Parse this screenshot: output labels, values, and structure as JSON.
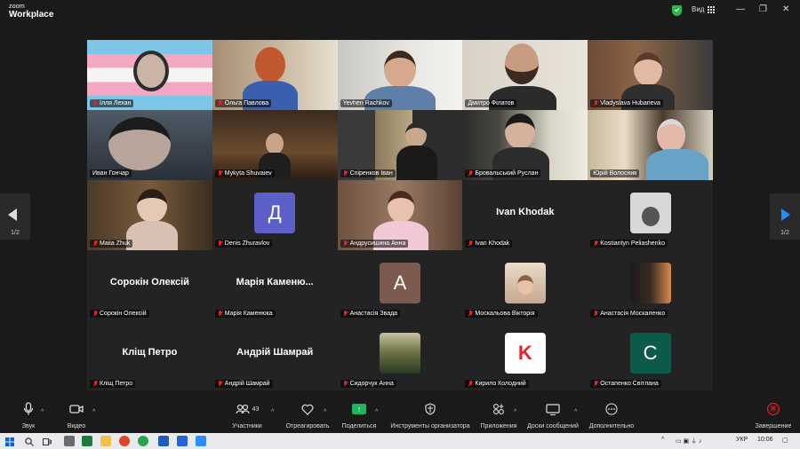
{
  "app": {
    "logo_top": "zoom",
    "logo_bottom": "Workplace",
    "view_label": "Вид"
  },
  "window_controls": {
    "minimize": "—",
    "restore": "❐",
    "close": "✕"
  },
  "participants": [
    {
      "name": "Ілля Лехан",
      "type": "video",
      "muted": true
    },
    {
      "name": "Ольга Павлова",
      "type": "video",
      "muted": true
    },
    {
      "name": "Yevhen Rachkov",
      "type": "video",
      "muted": false,
      "active": true
    },
    {
      "name": "Дмитро Філатов",
      "type": "video",
      "muted": false
    },
    {
      "name": "Vladyslava Hubarieva",
      "type": "video",
      "muted": true
    },
    {
      "name": "Иван Гончар",
      "type": "video",
      "muted": false
    },
    {
      "name": "Mykyta Shuvaiev",
      "type": "video",
      "muted": true
    },
    {
      "name": "Спіренков Іван",
      "type": "video",
      "muted": true
    },
    {
      "name": "Бровальський Руслан",
      "type": "video",
      "muted": true
    },
    {
      "name": "Юрій Волосник",
      "type": "video",
      "muted": false
    },
    {
      "name": "Maiia Zhuk",
      "type": "video",
      "muted": true
    },
    {
      "name": "Denis Zhuravlov",
      "type": "avatar",
      "initial": "Д",
      "muted": true
    },
    {
      "name": "Андрусишина Анна",
      "type": "video",
      "muted": true
    },
    {
      "name": "Ivan Khodak",
      "type": "name",
      "big": "Ivan Khodak",
      "muted": true
    },
    {
      "name": "Kostiantyn Peliashenko",
      "type": "photo",
      "muted": true
    },
    {
      "name": "Сорокін Олексій",
      "type": "name",
      "big": "Сорокін Олексій",
      "muted": true
    },
    {
      "name": "Марія Каменюка",
      "type": "name",
      "big": "Марія Каменю...",
      "muted": true
    },
    {
      "name": "Анастасія Звада",
      "type": "avatar",
      "initial": "A",
      "muted": true
    },
    {
      "name": "Москальова Вікторія",
      "type": "photo",
      "muted": true
    },
    {
      "name": "Анастасія Москаленко",
      "type": "photo",
      "muted": true
    },
    {
      "name": "Кліщ Петро",
      "type": "name",
      "big": "Кліщ Петро",
      "muted": true
    },
    {
      "name": "Андрій Шамрай",
      "type": "name",
      "big": "Андрій Шамрай",
      "muted": true
    },
    {
      "name": "Сидорчук Анна",
      "type": "photo",
      "muted": true
    },
    {
      "name": "Кирило Колодний",
      "type": "avatar",
      "initial": "K",
      "muted": true
    },
    {
      "name": "Остапенко Світлана",
      "type": "avatar",
      "initial": "C",
      "muted": true
    }
  ],
  "pagination": {
    "left": "1/2",
    "right": "1/2"
  },
  "toolbar": {
    "audio": "Звук",
    "video": "Видео",
    "participants": "Участники",
    "participants_count": "43",
    "react": "Отреагировать",
    "share": "Поделиться",
    "host_tools": "Инструменты организатора",
    "apps": "Приложения",
    "whiteboards": "Доски сообщений",
    "more": "Дополнительно",
    "end": "Завершение"
  },
  "taskbar": {
    "language": "УКР",
    "time": "10:06"
  },
  "colors": {
    "active_border": "#21c95a",
    "end_red": "#e0242c",
    "share_green": "#1fb35a",
    "avatar_purple": "#5b5fc7",
    "avatar_brown": "#7d5a4f",
    "avatar_teal": "#0c5a4a"
  }
}
